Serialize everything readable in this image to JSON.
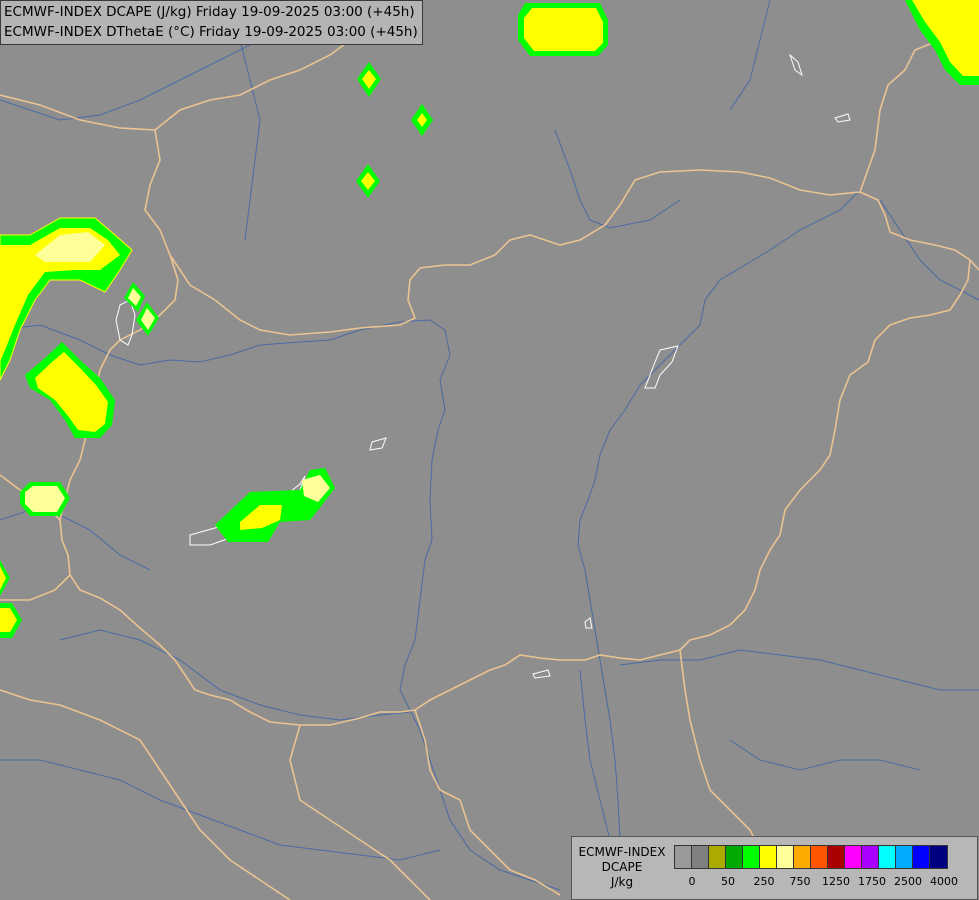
{
  "header": {
    "line1": "ECMWF-INDEX DCAPE (J/kg) Friday 19-09-2025 03:00 (+45h)",
    "line2": "ECMWF-INDEX DThetaE (°C) Friday 19-09-2025 03:00 (+45h)"
  },
  "legend": {
    "title_line1": "ECMWF-INDEX",
    "title_line2": "DCAPE",
    "unit": "J/kg",
    "colors": [
      "#9a9a9a",
      "#808080",
      "#aaaa00",
      "#00aa00",
      "#00ff00",
      "#ffff00",
      "#ffff99",
      "#ffaa00",
      "#ff5500",
      "#aa0000",
      "#ff00ff",
      "#aa00ff",
      "#00ffff",
      "#00aaff",
      "#0000ff",
      "#000080"
    ],
    "tick_labels": [
      "0",
      "50",
      "250",
      "750",
      "1250",
      "1750",
      "2500",
      "4000"
    ]
  },
  "colors": {
    "background": "#8e8e8e",
    "border": "#ebc391",
    "river": "#4a6aa6",
    "lake": "#ffffff",
    "dcape_green": "#00ff00",
    "dcape_yellow": "#ffff00",
    "dcape_lightyellow": "#ffff99"
  }
}
